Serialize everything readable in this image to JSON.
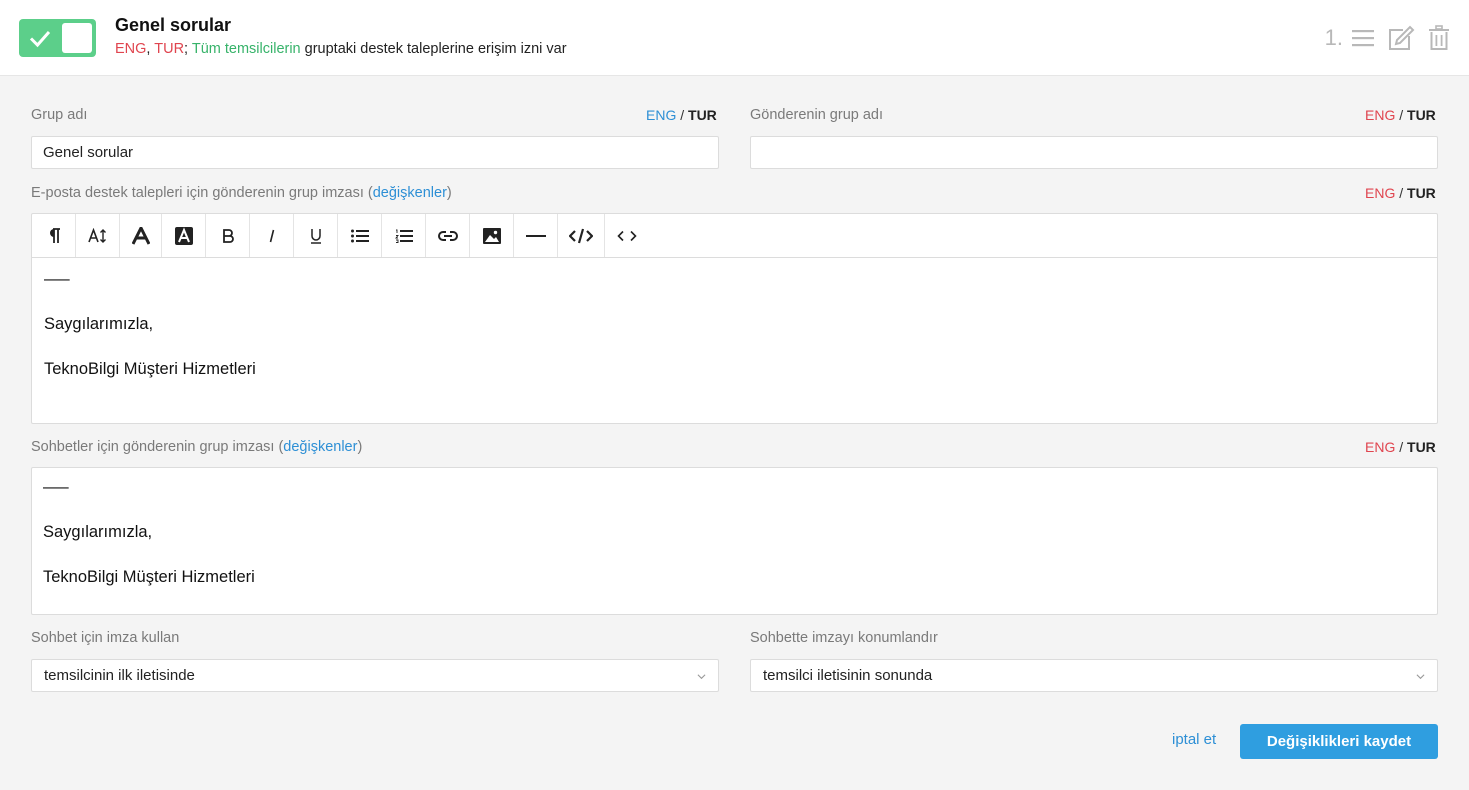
{
  "header": {
    "title": "Genel sorular",
    "subtitle": {
      "lang_eng": "ENG",
      "comma": ",",
      "lang_tur": "TUR",
      "semicolon": ";",
      "agents": "Tüm temsilcilerin",
      "rest": "gruptaki destek taleplerine erişim izni var"
    },
    "order_number": "1.",
    "toggle_state": "on",
    "icons": [
      "check-icon",
      "reorder-icon",
      "edit-icon",
      "trash-icon"
    ]
  },
  "lang_switch": {
    "eng": "ENG",
    "slash": "/",
    "tur": "TUR"
  },
  "fields": {
    "group_name": {
      "label": "Grup adı",
      "value": "Genel sorular"
    },
    "sender_group_name": {
      "label": "Gönderenin grup adı",
      "value": ""
    },
    "email_signature": {
      "label_prefix": "E-posta destek talepleri için gönderenin grup imzası (",
      "variables_link": "değişkenler",
      "label_suffix": ")",
      "lines": [
        "—–",
        "Saygılarımızla,",
        "TeknoBilgi Müşteri Hizmetleri"
      ]
    },
    "chat_signature": {
      "label_prefix": "Sohbetler için gönderenin grup imzası (",
      "variables_link": "değişkenler",
      "label_suffix": ")",
      "lines": [
        "—–",
        "Saygılarımızla,",
        "TeknoBilgi Müşteri Hizmetleri"
      ]
    },
    "use_signature": {
      "label": "Sohbet için imza kullan",
      "value": "temsilcinin ilk iletisinde"
    },
    "position_signature": {
      "label": "Sohbette imzayı konumlandır",
      "value": "temsilci iletisinin sonunda"
    }
  },
  "toolbar": {
    "buttons": [
      "paragraph-icon",
      "font-size-icon",
      "text-color-icon",
      "background-color-icon",
      "bold-icon",
      "italic-icon",
      "underline-icon",
      "bullet-list-icon",
      "numbered-list-icon",
      "link-icon",
      "image-icon",
      "horizontal-rule-icon",
      "code-view-icon",
      "source-code-icon"
    ]
  },
  "actions": {
    "cancel": "iptal et",
    "save": "Değişiklikleri kaydet"
  },
  "colors": {
    "toggle_green": "#5ccf8a",
    "accent_blue": "#2d8fd5",
    "lang_red": "#e0454f",
    "save_button": "#2f9ee0"
  }
}
